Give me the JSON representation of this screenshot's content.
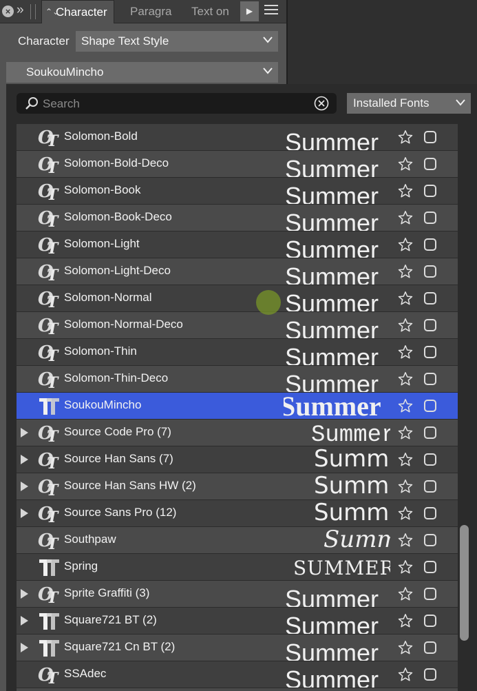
{
  "tabs": {
    "active": "Character",
    "others": [
      "Paragra",
      "Text on"
    ]
  },
  "character": {
    "label": "Character",
    "style_value": "Shape Text Style",
    "font_value": "SoukouMincho"
  },
  "search": {
    "placeholder": "Search",
    "value": ""
  },
  "filter": {
    "value": "Installed Fonts"
  },
  "fonts": [
    {
      "name": "Solomon-Bold",
      "type": "opentype-icon",
      "expandable": false,
      "selected": false,
      "preview": "Summer",
      "preview_style": "sans-cut"
    },
    {
      "name": "Solomon-Bold-Deco",
      "type": "opentype-icon",
      "expandable": false,
      "selected": false,
      "preview": "Summer",
      "preview_style": "sans-cut"
    },
    {
      "name": "Solomon-Book",
      "type": "opentype-icon",
      "expandable": false,
      "selected": false,
      "preview": "Summer",
      "preview_style": "sans-cut"
    },
    {
      "name": "Solomon-Book-Deco",
      "type": "opentype-icon",
      "expandable": false,
      "selected": false,
      "preview": "Summer",
      "preview_style": "sans-cut"
    },
    {
      "name": "Solomon-Light",
      "type": "opentype-icon",
      "expandable": false,
      "selected": false,
      "preview": "Summer",
      "preview_style": "sans-cut"
    },
    {
      "name": "Solomon-Light-Deco",
      "type": "opentype-icon",
      "expandable": false,
      "selected": false,
      "preview": "Summer",
      "preview_style": "sans-cut"
    },
    {
      "name": "Solomon-Normal",
      "type": "opentype-icon",
      "expandable": false,
      "selected": false,
      "preview": "Summer",
      "preview_style": "sans-cut"
    },
    {
      "name": "Solomon-Normal-Deco",
      "type": "opentype-icon",
      "expandable": false,
      "selected": false,
      "preview": "Summer",
      "preview_style": "sans-cut"
    },
    {
      "name": "Solomon-Thin",
      "type": "opentype-icon",
      "expandable": false,
      "selected": false,
      "preview": "Summer",
      "preview_style": "sans-cut"
    },
    {
      "name": "Solomon-Thin-Deco",
      "type": "opentype-icon",
      "expandable": false,
      "selected": false,
      "preview": "Summer",
      "preview_style": "sans-cut"
    },
    {
      "name": "SoukouMincho",
      "type": "truetype-icon",
      "expandable": false,
      "selected": true,
      "preview": "Summer",
      "preview_style": "serif-bold"
    },
    {
      "name": "Source Code Pro (7)",
      "type": "opentype-icon",
      "expandable": true,
      "selected": false,
      "preview": "Summer",
      "preview_style": "mono"
    },
    {
      "name": "Source Han Sans (7)",
      "type": "opentype-icon",
      "expandable": true,
      "selected": false,
      "preview": "Summer",
      "preview_style": "sans-large"
    },
    {
      "name": "Source Han Sans HW (2)",
      "type": "opentype-icon",
      "expandable": true,
      "selected": false,
      "preview": "Summer",
      "preview_style": "sans-large"
    },
    {
      "name": "Source Sans Pro (12)",
      "type": "opentype-icon",
      "expandable": true,
      "selected": false,
      "preview": "Summer",
      "preview_style": "sans-large"
    },
    {
      "name": "Southpaw",
      "type": "opentype-icon",
      "expandable": false,
      "selected": false,
      "preview": "Summer",
      "preview_style": "script"
    },
    {
      "name": "Spring",
      "type": "truetype-icon",
      "expandable": false,
      "selected": false,
      "preview": "SUMMER",
      "preview_style": "deco-caps"
    },
    {
      "name": "Sprite Graffiti (3)",
      "type": "opentype-icon",
      "expandable": true,
      "selected": false,
      "preview": "Summer",
      "preview_style": "sans-cut"
    },
    {
      "name": "Square721 BT (2)",
      "type": "truetype-icon",
      "expandable": true,
      "selected": false,
      "preview": "Summer",
      "preview_style": "sans-cut"
    },
    {
      "name": "Square721 Cn BT (2)",
      "type": "truetype-icon",
      "expandable": true,
      "selected": false,
      "preview": "Summer",
      "preview_style": "sans-cut"
    },
    {
      "name": "SSAdec",
      "type": "opentype-icon",
      "expandable": false,
      "selected": false,
      "preview": "Summer",
      "preview_style": "sans-cut"
    },
    {
      "name": "",
      "type": "truetype-icon",
      "expandable": false,
      "selected": false,
      "preview": "",
      "preview_style": "sans-cut"
    }
  ],
  "colors": {
    "panel_bg": "#535353",
    "popup_bg": "#2b2b2b",
    "row_bg": "#3f3f3f",
    "row_alt_bg": "#4a4a4a",
    "selected_bg": "#3b5bdb",
    "dropdown_bg": "#6b6b6b"
  }
}
